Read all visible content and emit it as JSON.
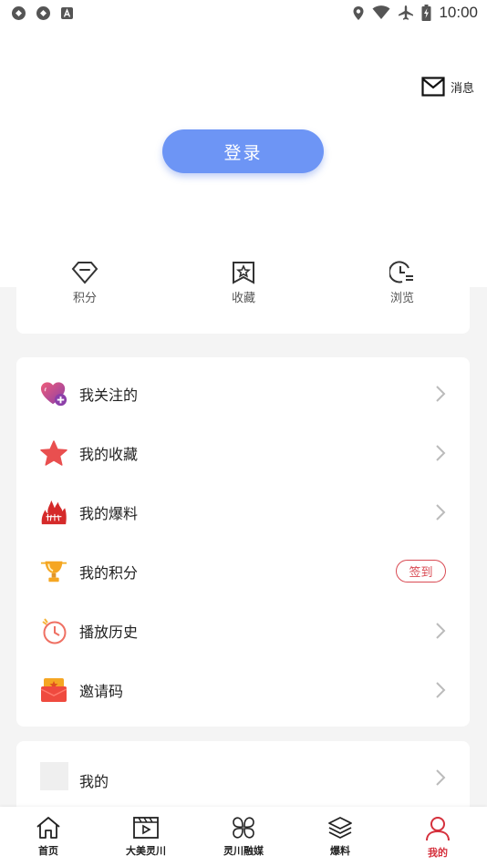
{
  "status_bar": {
    "time": "10:00"
  },
  "header": {
    "message_label": "消息",
    "login_label": "登录"
  },
  "stats": [
    {
      "label": "积分",
      "icon": "diamond-icon"
    },
    {
      "label": "收藏",
      "icon": "bookmark-star-icon"
    },
    {
      "label": "浏览",
      "icon": "clock-list-icon"
    }
  ],
  "menu": [
    {
      "label": "我关注的",
      "icon": "heart-plus-icon"
    },
    {
      "label": "我的收藏",
      "icon": "star-icon"
    },
    {
      "label": "我的爆料",
      "icon": "flame-icon"
    },
    {
      "label": "我的积分",
      "icon": "trophy-icon",
      "action_label": "签到"
    },
    {
      "label": "播放历史",
      "icon": "timer-icon"
    },
    {
      "label": "邀请码",
      "icon": "red-envelope-icon"
    }
  ],
  "mine": {
    "label": "我的"
  },
  "tabs": [
    {
      "label": "首页",
      "icon": "home-icon"
    },
    {
      "label": "大美灵川",
      "icon": "video-icon"
    },
    {
      "label": "灵川融媒",
      "icon": "clover-icon"
    },
    {
      "label": "爆料",
      "icon": "layers-icon"
    },
    {
      "label": "我的",
      "icon": "person-icon",
      "active": true
    }
  ],
  "colors": {
    "login_button": "#6d95f5",
    "accent_red": "#d5303c",
    "background": "#f4f4f4"
  }
}
